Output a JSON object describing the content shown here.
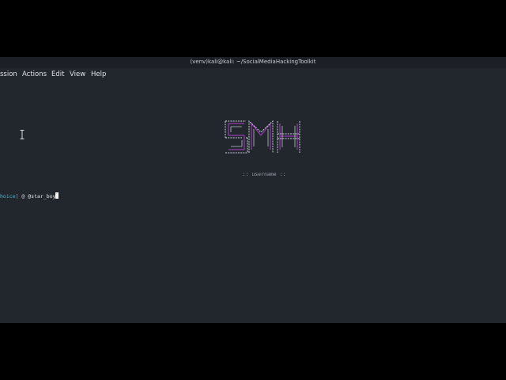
{
  "window": {
    "title": "(venv)kali@kali: ~/SocialMediaHackingToolkit"
  },
  "menu": {
    "items": [
      "ssion",
      "Actions",
      "Edit",
      "View",
      "Help"
    ]
  },
  "terminal": {
    "banner_text": "SMH",
    "subtitle": ":: username ::",
    "prompt": {
      "prefix": "hoice]",
      "symbol": "@",
      "input": "@star_boy"
    }
  },
  "colors": {
    "terminal_background": "#22262d",
    "titlebar_background": "#1c1f25",
    "outer_background": "#000000",
    "banner_primary": "#c9d3df",
    "banner_accent": "#9a3fb3",
    "prompt_accent": "#58b3c9"
  },
  "icons": {
    "text_cursor": "ibeam-cursor-icon"
  }
}
